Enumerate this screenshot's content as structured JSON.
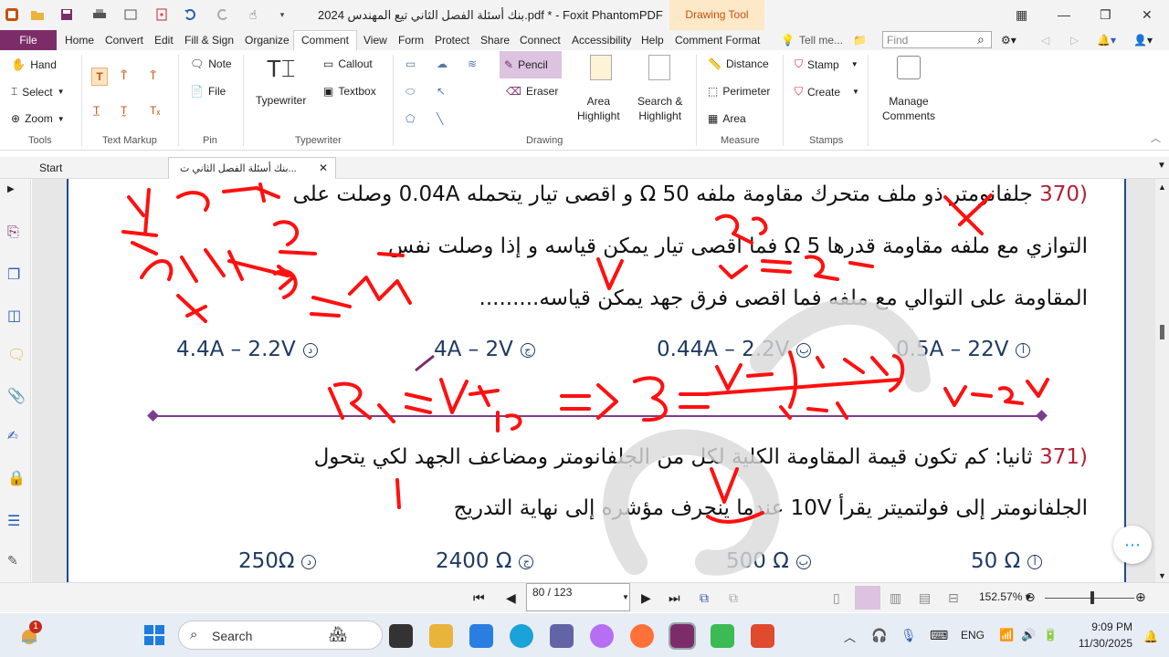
{
  "title_bar": {
    "document_title": "بنك أسئلة الفصل الثاني تيع المهندس 2024.pdf * - Foxit PhantomPDF",
    "context_tab": "Drawing Tool"
  },
  "ribbon_tabs": [
    "File",
    "Home",
    "Convert",
    "Edit",
    "Fill & Sign",
    "Organize",
    "Comment",
    "View",
    "Form",
    "Protect",
    "Share",
    "Connect",
    "Accessibility",
    "Help",
    "Comment Format"
  ],
  "tell_me": "Tell me...",
  "find_placeholder": "Find",
  "ribbon": {
    "tools": {
      "hand": "Hand",
      "select": "Select",
      "zoom": "Zoom",
      "label": "Tools"
    },
    "text_markup": {
      "label": "Text Markup"
    },
    "pin": {
      "note": "Note",
      "file": "File",
      "label": "Pin"
    },
    "typewriter": {
      "typewriter": "Typewriter",
      "callout": "Callout",
      "textbox": "Textbox",
      "label": "Typewriter"
    },
    "drawing": {
      "pencil": "Pencil",
      "eraser": "Eraser",
      "area_highlight": "Area\nHighlight",
      "search_highlight": "Search &\nHighlight",
      "label": "Drawing"
    },
    "measure": {
      "distance": "Distance",
      "perimeter": "Perimeter",
      "area": "Area",
      "label": "Measure"
    },
    "stamps": {
      "stamp": "Stamp",
      "create": "Create",
      "label": "Stamps"
    },
    "manage": {
      "manage_comments": "Manage\nComments"
    }
  },
  "doc_tabs": {
    "start": "Start",
    "file": "بنك أسئلة الفصل الثاني ت..."
  },
  "document": {
    "q370": {
      "number": "(370",
      "line1": "جلفانومتر ذو ملف متحرك مقاومة ملفه Ω 50 و اقصى تيار يتحمله 0.04A وصلت على",
      "line2": "التوازي مع ملفه مقاومة قدرها Ω 5 فما اقصى تيار يمكن قياسه و إذا وصلت نفس",
      "line3": "المقاومة على التوالي مع ملفه فما اقصى فرق جهد يمكن قياسه.........",
      "options": [
        {
          "mark": "أ",
          "text": "0.5A – 22V"
        },
        {
          "mark": "ب",
          "text": "0.44A – 2.2V"
        },
        {
          "mark": "ج",
          "text": "4A – 2V"
        },
        {
          "mark": "د",
          "text": "4.4A – 2.2V"
        }
      ]
    },
    "q371": {
      "number": "(371",
      "line1": "ثانيا: كم تكون قيمة المقاومة الكلية لكل من الجلفانومتر ومضاعف الجهد لكي يتحول",
      "line2": "الجلفانومتر إلى فولتميتر يقرأ 10V عندما ينحرف مؤشره إلى نهاية التدريج",
      "options": [
        {
          "mark": "أ",
          "text": "50 Ω"
        },
        {
          "mark": "ب",
          "text": "500 Ω"
        },
        {
          "mark": "ج",
          "text": "2400 Ω"
        },
        {
          "mark": "د",
          "text": "250Ω"
        }
      ]
    }
  },
  "status": {
    "page": "80 / 123",
    "zoom": "152.57%"
  },
  "taskbar": {
    "search": "Search",
    "lang": "ENG",
    "time": "9:09 PM",
    "date": "11/30/2025",
    "badge": "1"
  },
  "colors": {
    "brand": "#7d2c6a",
    "accent": "#c5530c",
    "ink": "#ff0000",
    "question_number": "#b32035"
  }
}
